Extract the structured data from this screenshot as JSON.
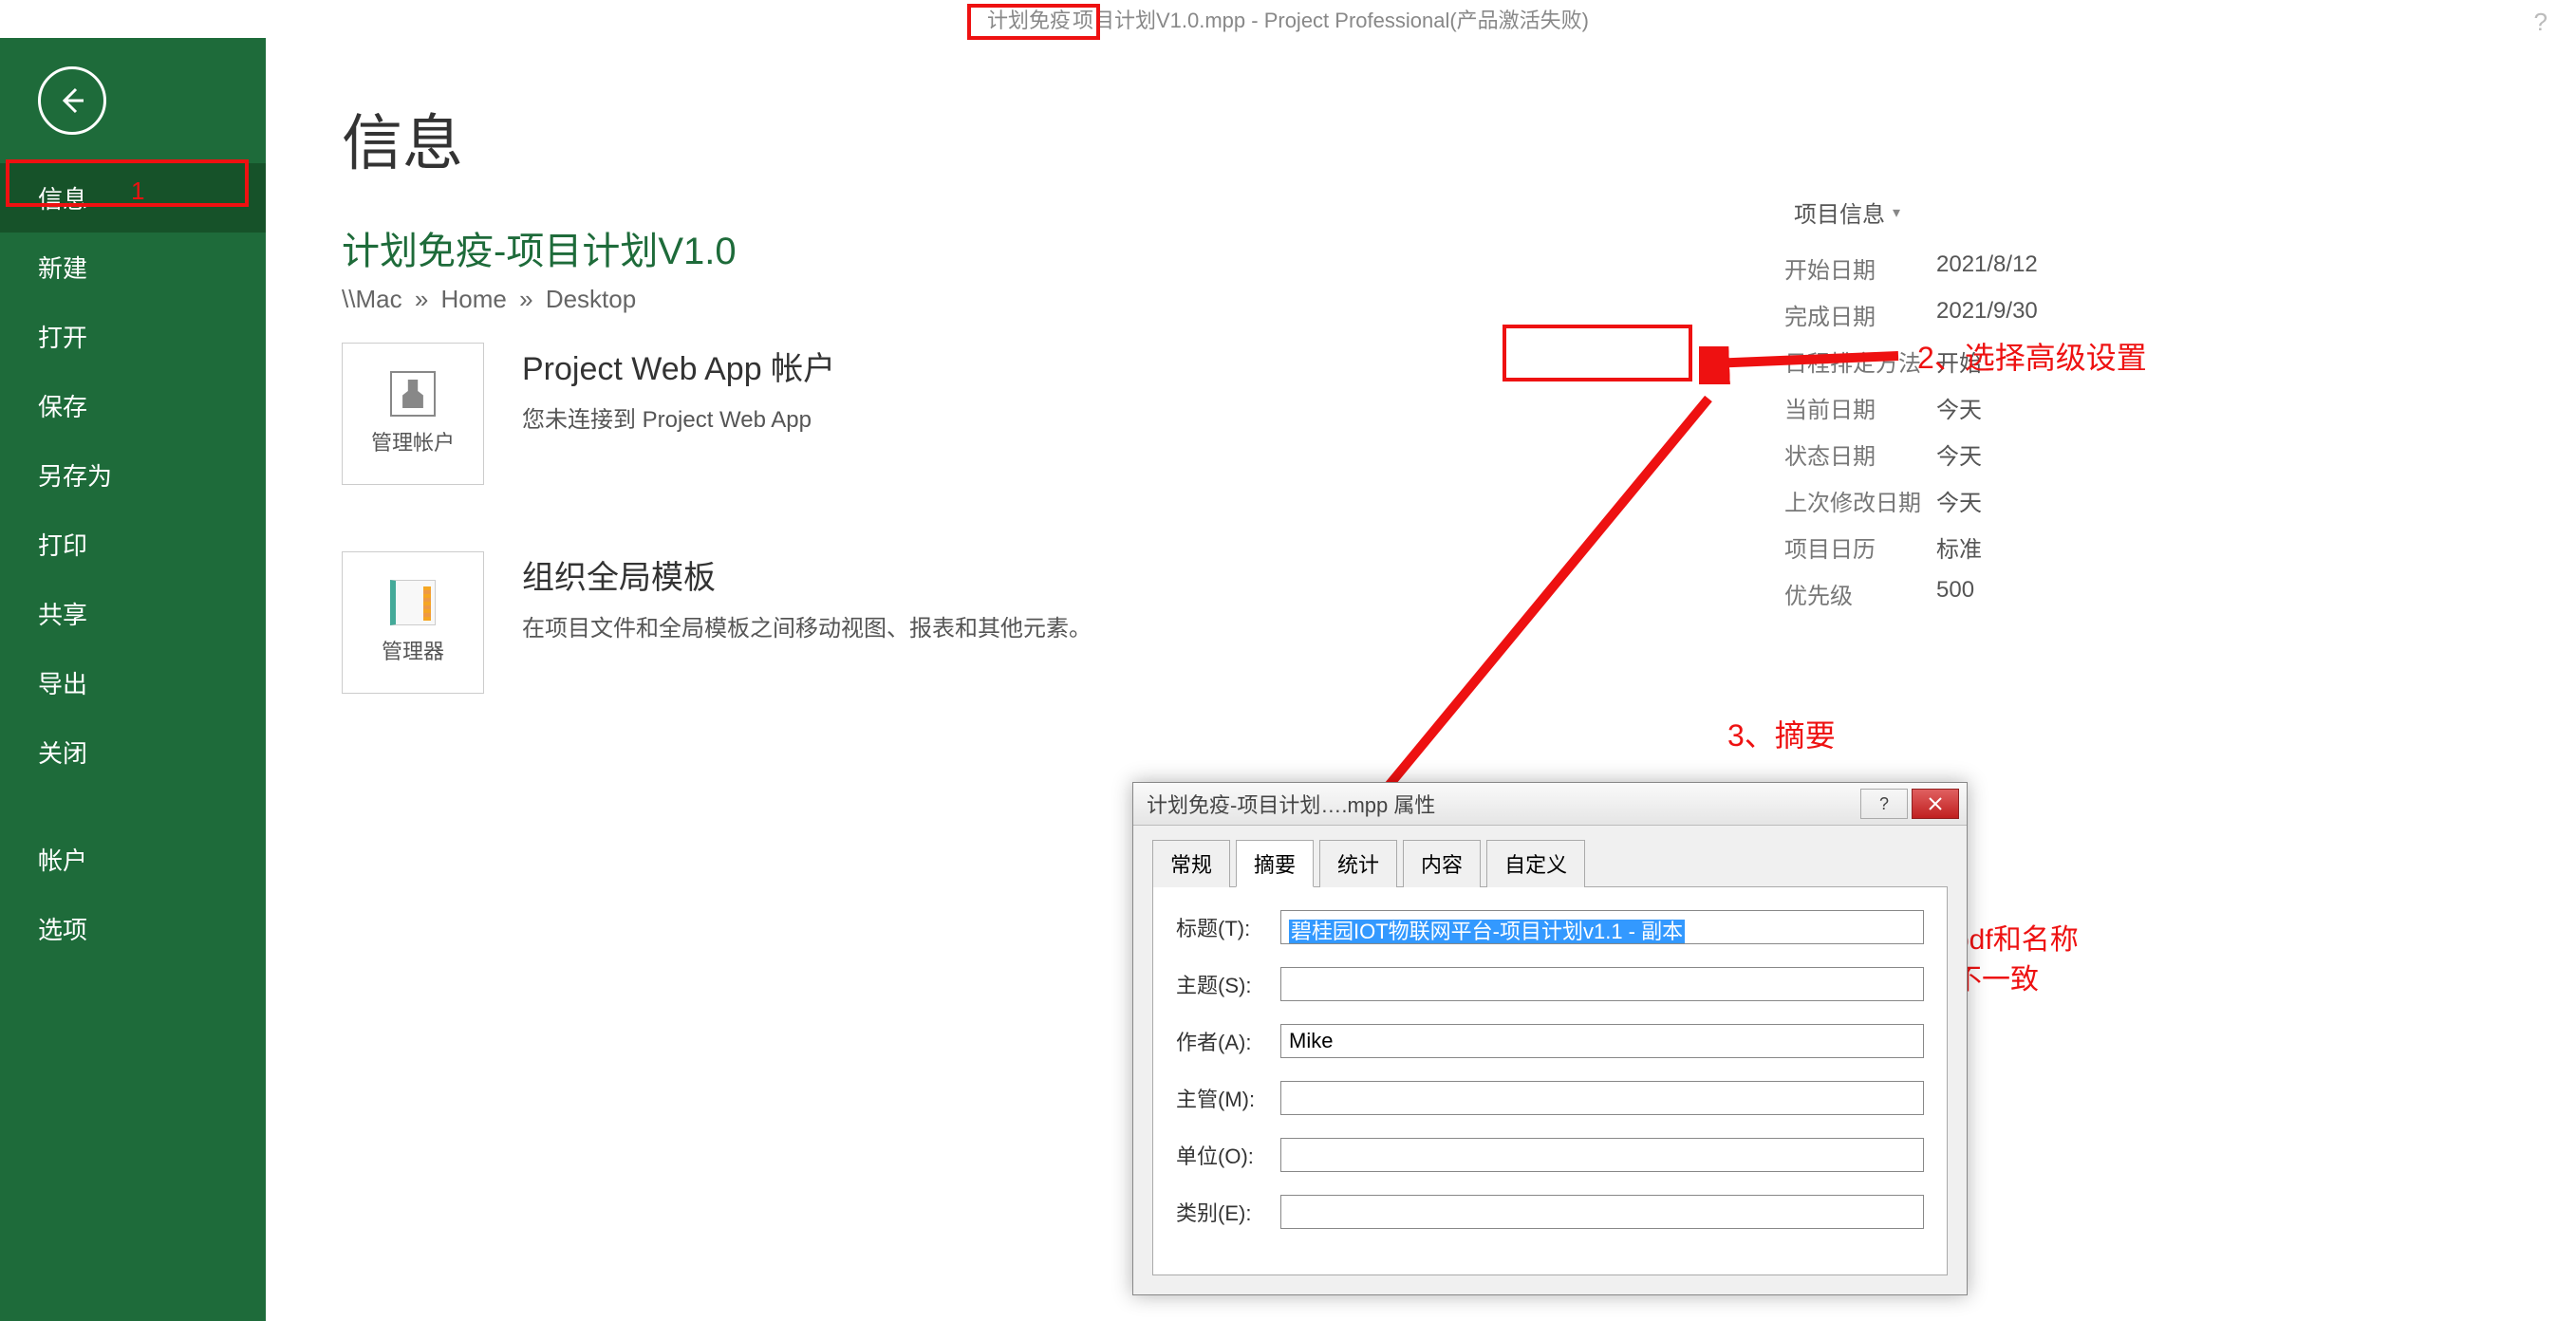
{
  "titlebar": {
    "highlighted_prefix": "计划免疫",
    "rest": "项目计划V1.0.mpp - Project Professional(产品激活失败)"
  },
  "sidebar": {
    "items": [
      {
        "label": "信息",
        "active": true
      },
      {
        "label": "新建"
      },
      {
        "label": "打开"
      },
      {
        "label": "保存"
      },
      {
        "label": "另存为"
      },
      {
        "label": "打印"
      },
      {
        "label": "共享"
      },
      {
        "label": "导出"
      },
      {
        "label": "关闭"
      }
    ],
    "bottom": [
      {
        "label": "帐户"
      },
      {
        "label": "选项"
      }
    ]
  },
  "page": {
    "title": "信息",
    "doc_title": "计划免疫-项目计划V1.0",
    "breadcrumb": [
      "\\\\Mac",
      "Home",
      "Desktop"
    ],
    "pwa": {
      "tile_label": "管理帐户",
      "heading": "Project Web App 帐户",
      "desc": "您未连接到 Project Web App"
    },
    "org": {
      "tile_label": "管理器",
      "heading": "组织全局模板",
      "desc": "在项目文件和全局模板之间移动视图、报表和其他元素。"
    }
  },
  "proj_info": {
    "button": "项目信息",
    "rows": [
      {
        "label": "开始日期",
        "val": "2021/8/12"
      },
      {
        "label": "完成日期",
        "val": "2021/9/30"
      },
      {
        "label": "日程排定方法",
        "val": "开始"
      },
      {
        "label": "当前日期",
        "val": "今天"
      },
      {
        "label": "状态日期",
        "val": "今天"
      },
      {
        "label": "上次修改日期",
        "val": "今天"
      },
      {
        "label": "项目日历",
        "val": "标准"
      },
      {
        "label": "优先级",
        "val": "500"
      }
    ]
  },
  "dialog": {
    "title_prefix": "计划免疫-项目计划",
    "title_suffix": ".mpp 属性",
    "tabs": [
      "常规",
      "摘要",
      "统计",
      "内容",
      "自定义"
    ],
    "active_tab": "摘要",
    "fields": {
      "title": {
        "label": "标题(T):",
        "value": "碧桂园IOT物联网平台-项目计划v1.1 - 副本"
      },
      "subject": {
        "label": "主题(S):",
        "value": ""
      },
      "author": {
        "label": "作者(A):",
        "value": "Mike"
      },
      "manager": {
        "label": "主管(M):",
        "value": ""
      },
      "company": {
        "label": "单位(O):",
        "value": ""
      },
      "category": {
        "label": "类别(E):",
        "value": ""
      }
    }
  },
  "annotations": {
    "a1": "1",
    "a2": "2、选择高级设置",
    "a3": "3、摘要",
    "a4_line1": "发现导出成pdf和名称",
    "a4_line2": "和文件名称不一致"
  }
}
